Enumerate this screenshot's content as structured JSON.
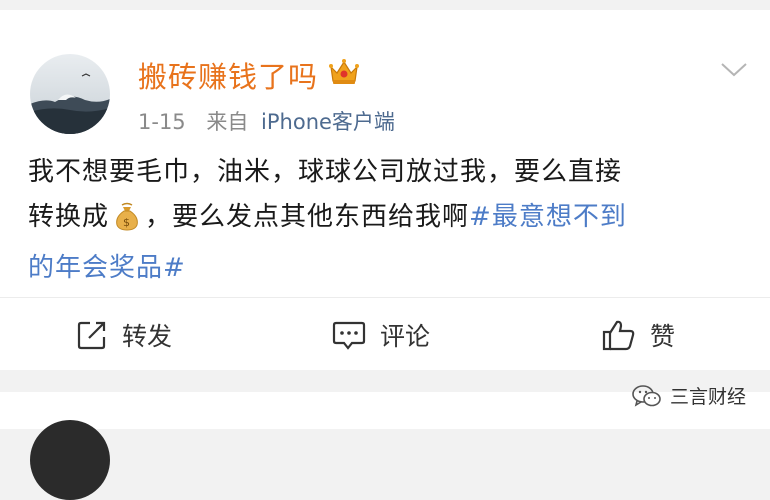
{
  "post": {
    "username": "搬砖赚钱了吗",
    "badge_icon": "crown-icon",
    "date": "1-15",
    "from_label": "来自",
    "source": "iPhone客户端",
    "content": {
      "line1": "我不想要毛巾，油米，球球公司放过我，要么直接",
      "line2_before": "转换成",
      "emoji_icon": "money-bag-icon",
      "line2_after": "，要么发点其他东西给我啊",
      "hashtag_part1": "#最意想不到",
      "hashtag_part2": "的年会奖品#"
    }
  },
  "actions": {
    "repost_label": "转发",
    "comment_label": "评论",
    "like_label": "赞"
  },
  "watermark": {
    "text": "三言财经"
  },
  "colors": {
    "username": "#e8731c",
    "hashtag": "#4d7cc7",
    "source": "#4d6a8f"
  }
}
